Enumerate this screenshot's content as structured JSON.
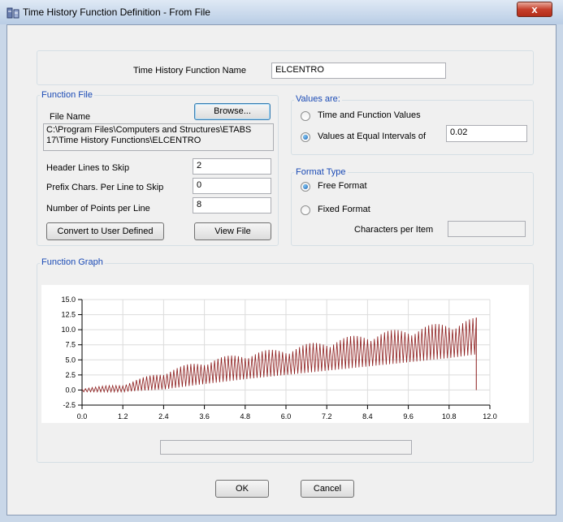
{
  "window": {
    "title": "Time History Function Definition  - From File",
    "close_label": "x"
  },
  "name_section": {
    "label": "Time History Function Name",
    "value": "ELCENTRO"
  },
  "function_file": {
    "legend": "Function File",
    "file_name_label": "File Name",
    "browse_label": "Browse...",
    "path_line1": "C:\\Program Files\\Computers and Structures\\ETABS",
    "path_line2": "17\\Time History Functions\\ELCENTRO",
    "header_lines_label": "Header Lines to Skip",
    "header_lines_value": "2",
    "prefix_chars_label": "Prefix Chars. Per Line to Skip",
    "prefix_chars_value": "0",
    "points_per_line_label": "Number of Points per Line",
    "points_per_line_value": "8",
    "convert_label": "Convert to User Defined",
    "view_file_label": "View File"
  },
  "values_are": {
    "legend": "Values are:",
    "option1_label": "Time and Function Values",
    "option2_label": "Values at Equal Intervals of",
    "interval_value": "0.02",
    "selected": "option2"
  },
  "format_type": {
    "legend": "Format Type",
    "free_label": "Free Format",
    "fixed_label": "Fixed Format",
    "chars_per_item_label": "Characters per Item",
    "chars_per_item_value": "",
    "selected": "free"
  },
  "graph": {
    "legend": "Function Graph"
  },
  "chart_data": {
    "type": "line",
    "x_ticks": [
      "0.0",
      "1.2",
      "2.4",
      "3.6",
      "4.8",
      "6.0",
      "7.2",
      "8.4",
      "9.6",
      "10.8",
      "12.0"
    ],
    "y_ticks": [
      "15.0",
      "12.5",
      "10.0",
      "7.5",
      "5.0",
      "2.5",
      "0.0",
      "-2.5"
    ],
    "xlim": [
      0,
      12
    ],
    "ylim": [
      -2.5,
      15
    ],
    "grid": true,
    "series_color": "#8b1a1a",
    "envelope": {
      "x": [
        0.0,
        1.2,
        2.4,
        3.6,
        4.8,
        6.0,
        7.2,
        8.4,
        9.6,
        10.8,
        11.6
      ],
      "upper": [
        0.3,
        1.0,
        3.2,
        5.0,
        6.2,
        7.0,
        8.3,
        9.4,
        10.3,
        11.3,
        12.0
      ],
      "lower": [
        -0.3,
        -0.3,
        0.1,
        1.0,
        1.8,
        2.5,
        3.2,
        3.9,
        4.6,
        5.3,
        5.9
      ]
    },
    "x_end": 11.6,
    "dt": 0.02
  },
  "buttons": {
    "ok_label": "OK",
    "cancel_label": "Cancel"
  }
}
